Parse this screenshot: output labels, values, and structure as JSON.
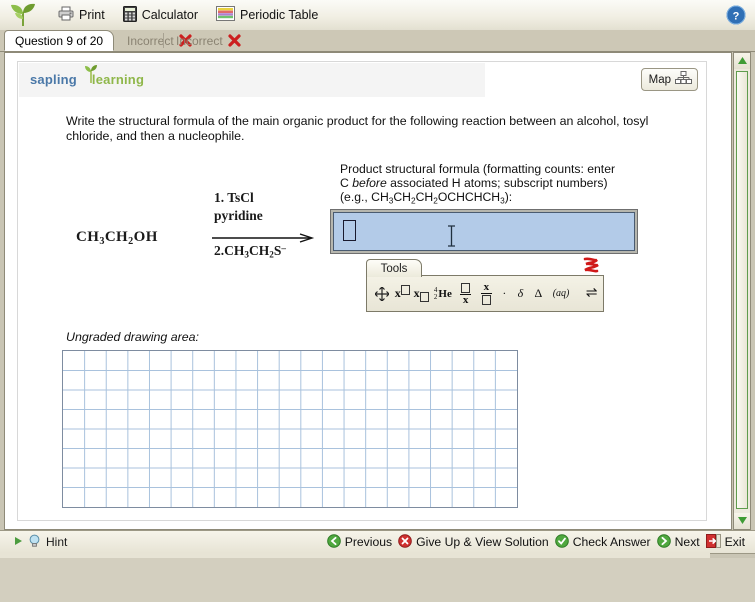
{
  "toolbar": {
    "logo_icon": "sapling-leaf-icon",
    "items": [
      {
        "label": "Print",
        "icon": "printer-icon"
      },
      {
        "label": "Calculator",
        "icon": "calculator-icon"
      },
      {
        "label": "Periodic Table",
        "icon": "periodic-table-icon"
      }
    ],
    "help_icon": "help-globe-icon"
  },
  "tabs": {
    "active": {
      "label": "Question 9 of 20"
    },
    "inactive": [
      {
        "label": "Incorrect",
        "icon": "red-x-icon"
      },
      {
        "label": "Incorrect",
        "icon": "red-x-icon"
      }
    ]
  },
  "brand": {
    "word1": "sapling",
    "word2": "learning",
    "color1": "#4a78a8",
    "color2": "#8fb74a"
  },
  "map_button": {
    "label": "Map",
    "icon": "site-map-icon"
  },
  "question": {
    "text": "Write the structural formula of the main organic product for the following reaction between an alcohol, tosyl chloride, and then a nucleophile."
  },
  "reaction": {
    "reactant": "CH3CH2OH",
    "condition_top_line1": "1. TsCl",
    "condition_top_line2": "pyridine",
    "condition_bottom": "2. CH3CH2S-"
  },
  "answer": {
    "label_line1": "Product structural formula (formatting counts:",
    "label_line2_a": "enter C ",
    "label_line2_em": "before",
    "label_line2_b": " associated H atoms; subscript",
    "label_line3": "numbers) (e.g., CH3CH2CH2OCHCHCH3):",
    "value": "",
    "box_color": "#b3cbe8"
  },
  "tools": {
    "title": "Tools",
    "corner_icon": "red-ribbon-icon",
    "buttons": [
      {
        "name": "move-tool",
        "label": "move"
      },
      {
        "name": "superscript-tool",
        "label": "x superscript"
      },
      {
        "name": "subscript-tool",
        "label": "x subscript"
      },
      {
        "name": "isotope-tool",
        "label": "He isotope"
      },
      {
        "name": "fraction-numerator-tool",
        "label": "box over x"
      },
      {
        "name": "fraction-denominator-tool",
        "label": "x over box"
      },
      {
        "name": "dot-tool",
        "label": "·"
      },
      {
        "name": "delta-tool",
        "label": "δ"
      },
      {
        "name": "triangle-tool",
        "label": "Δ"
      },
      {
        "name": "aqueous-tool",
        "label": "(aq)"
      },
      {
        "name": "equilibrium-tool",
        "label": "⇌"
      }
    ]
  },
  "drawing": {
    "label": "Ungraded drawing area:",
    "columns": 21,
    "rows": 8,
    "line_color": "#a9c2dd"
  },
  "footer": {
    "hint": {
      "label": "Hint",
      "icon": "lightbulb-icon",
      "expander_icon": "green-triangle-icon"
    },
    "buttons": [
      {
        "label": "Previous",
        "icon": "green-back-icon"
      },
      {
        "label": "Give Up & View Solution",
        "icon": "red-x-circle-icon"
      },
      {
        "label": "Check Answer",
        "icon": "green-check-icon"
      },
      {
        "label": "Next",
        "icon": "green-forward-icon"
      },
      {
        "label": "Exit",
        "icon": "red-exit-icon"
      }
    ]
  },
  "scrollbar": {
    "up_icon": "green-up-arrow-icon",
    "down_icon": "green-down-arrow-icon"
  }
}
